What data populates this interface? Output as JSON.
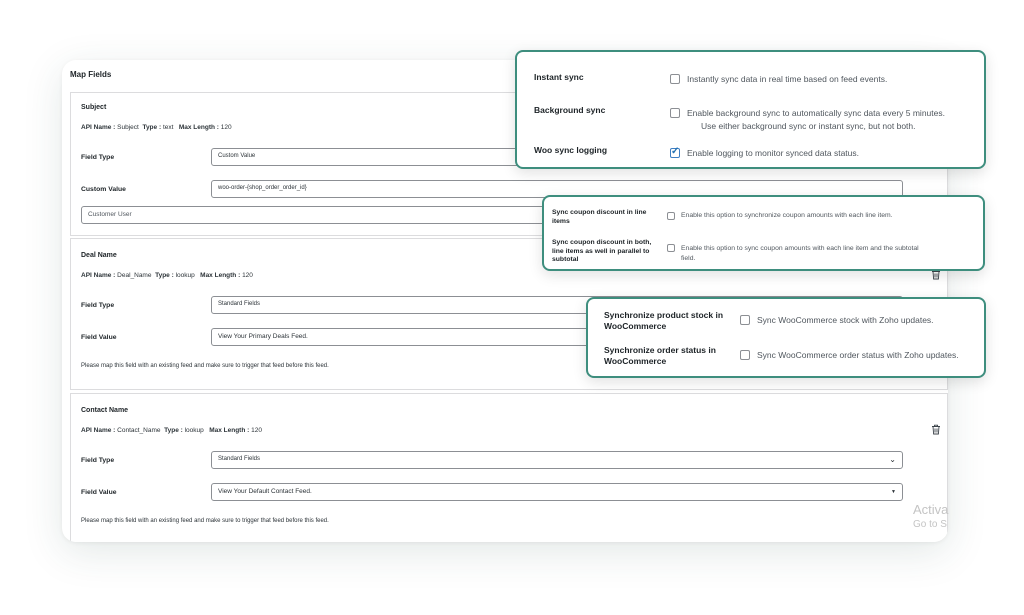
{
  "map_fields": {
    "title": "Map Fields",
    "subject": {
      "title": "Subject",
      "api_label": "API Name :",
      "api_value": "Subject",
      "type_label": "Type :",
      "type_value": "text",
      "max_label": "Max Length :",
      "max_value": "120",
      "field_type_label": "Field Type",
      "field_type_value": "Custom Value",
      "custom_value_label": "Custom Value",
      "custom_value_value": "woo-order-{shop_order_order_id}",
      "secondary_field_value": "Customer User"
    },
    "deal_name": {
      "title": "Deal Name",
      "api_label": "API Name :",
      "api_value": "Deal_Name",
      "type_label": "Type :",
      "type_value": "lookup",
      "max_label": "Max Length :",
      "max_value": "120",
      "field_type_label": "Field Type",
      "field_type_value": "Standard Fields",
      "field_value_label": "Field Value",
      "field_value_value": "View Your Primary Deals Feed.",
      "note": "Please map this field with an existing feed and make sure to trigger that feed before this feed."
    },
    "contact_name": {
      "title": "Contact Name",
      "api_label": "API Name :",
      "api_value": "Contact_Name",
      "type_label": "Type :",
      "type_value": "lookup",
      "max_label": "Max Length :",
      "max_value": "120",
      "field_type_label": "Field Type",
      "field_type_value": "Standard Fields",
      "field_value_label": "Field Value",
      "field_value_value": "View Your Default Contact Feed.",
      "note": "Please map this field with an existing feed and make sure to trigger that feed before this feed."
    }
  },
  "watermark": {
    "line1": "Activa",
    "line2": "Go to S"
  },
  "sync_popup": {
    "rows": [
      {
        "label": "Instant sync",
        "text": "Instantly sync data in real time based on feed events.",
        "checked": false
      },
      {
        "label": "Background sync",
        "text": "Enable background sync to automatically sync data every 5 minutes.",
        "text2": "Use either background sync or instant sync, but not both.",
        "checked": false
      },
      {
        "label": "Woo sync logging",
        "text": "Enable logging to monitor synced data status.",
        "checked": true
      }
    ]
  },
  "coupon_popup": {
    "rows": [
      {
        "label1": "Sync coupon discount in line",
        "label2": "items",
        "text": "Enable this option to synchronize coupon amounts with each line item.",
        "checked": false
      },
      {
        "label1": "Sync coupon discount in both,",
        "label2": "line items as well in parallel to",
        "label3": "subtotal",
        "text": "Enable this option to sync coupon amounts with each line item and the subtotal",
        "text2": "field.",
        "checked": false
      }
    ]
  },
  "stock_popup": {
    "rows": [
      {
        "label1": "Synchronize product stock in",
        "label2": "WooCommerce",
        "text": "Sync WooCommerce stock with Zoho updates.",
        "checked": false
      },
      {
        "label1": "Synchronize order status in",
        "label2": "WooCommerce",
        "text": "Sync WooCommerce order status with Zoho updates.",
        "checked": false
      }
    ]
  },
  "colors": {
    "accent_border": "#3e8e7e",
    "checkbox_checked": "#2271b1"
  },
  "icons": {
    "delete": "trash-icon",
    "dropdown": "chevron-down-icon"
  }
}
